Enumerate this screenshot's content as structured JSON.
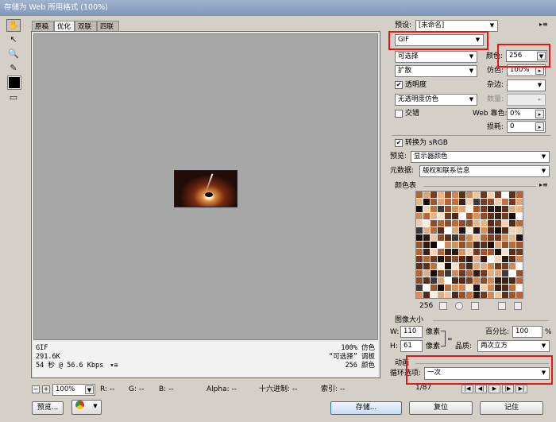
{
  "window": {
    "title": "存储为 Web 所用格式 (100%)"
  },
  "tabs": [
    "原稿",
    "优化",
    "双联",
    "四联"
  ],
  "status": {
    "left": [
      "GIF",
      "291.6K",
      "54 秒 @ 56.6 Kbps"
    ],
    "right": [
      "100% 仿色",
      "“可选择” 调板",
      "256 颜色"
    ],
    "menu_icon": "menu-icon"
  },
  "zoom": {
    "value": "100%"
  },
  "readouts": {
    "r": "R: --",
    "g": "G: --",
    "b": "B: --",
    "alpha": "Alpha: --",
    "hex": "十六进制: --",
    "index": "索引: --"
  },
  "buttons": {
    "preview": "预览...",
    "save": "存储...",
    "reset": "复位",
    "remember": "记住"
  },
  "settings": {
    "preset_label": "预设:",
    "preset_value": "[未命名]",
    "format": "GIF",
    "reduction": "可选择",
    "colors_label": "颜色:",
    "colors_value": "256",
    "dither_algo": "扩散",
    "dither_label": "仿色:",
    "dither_value": "100%",
    "transparency_label": "透明度",
    "matte_label": "杂边:",
    "transparency_dither": "无透明度仿色",
    "amount_label": "数量:",
    "interlaced_label": "交错",
    "web_snap_label": "Web 靠色:",
    "web_snap_value": "0%",
    "lossy_label": "损耗:",
    "lossy_value": "0",
    "srgb_label": "转换为 sRGB",
    "preview_label": "预览:",
    "preview_value": "显示器颜色",
    "metadata_label": "元数据:",
    "metadata_value": "版权和联系信息"
  },
  "color_table": {
    "title": "颜色表",
    "count": "256"
  },
  "image_size": {
    "title": "图像大小",
    "w_label": "W:",
    "w_value": "110",
    "h_label": "H:",
    "h_value": "61",
    "unit": "像素",
    "percent_label": "百分比:",
    "percent_value": "100",
    "percent_unit": "%",
    "quality_label": "品质:",
    "quality_value": "两次立方"
  },
  "animation": {
    "title": "动画",
    "loop_label": "循环选项:",
    "loop_value": "一次",
    "frame": "1/87"
  },
  "colors": {
    "highlight": "#e01818"
  }
}
